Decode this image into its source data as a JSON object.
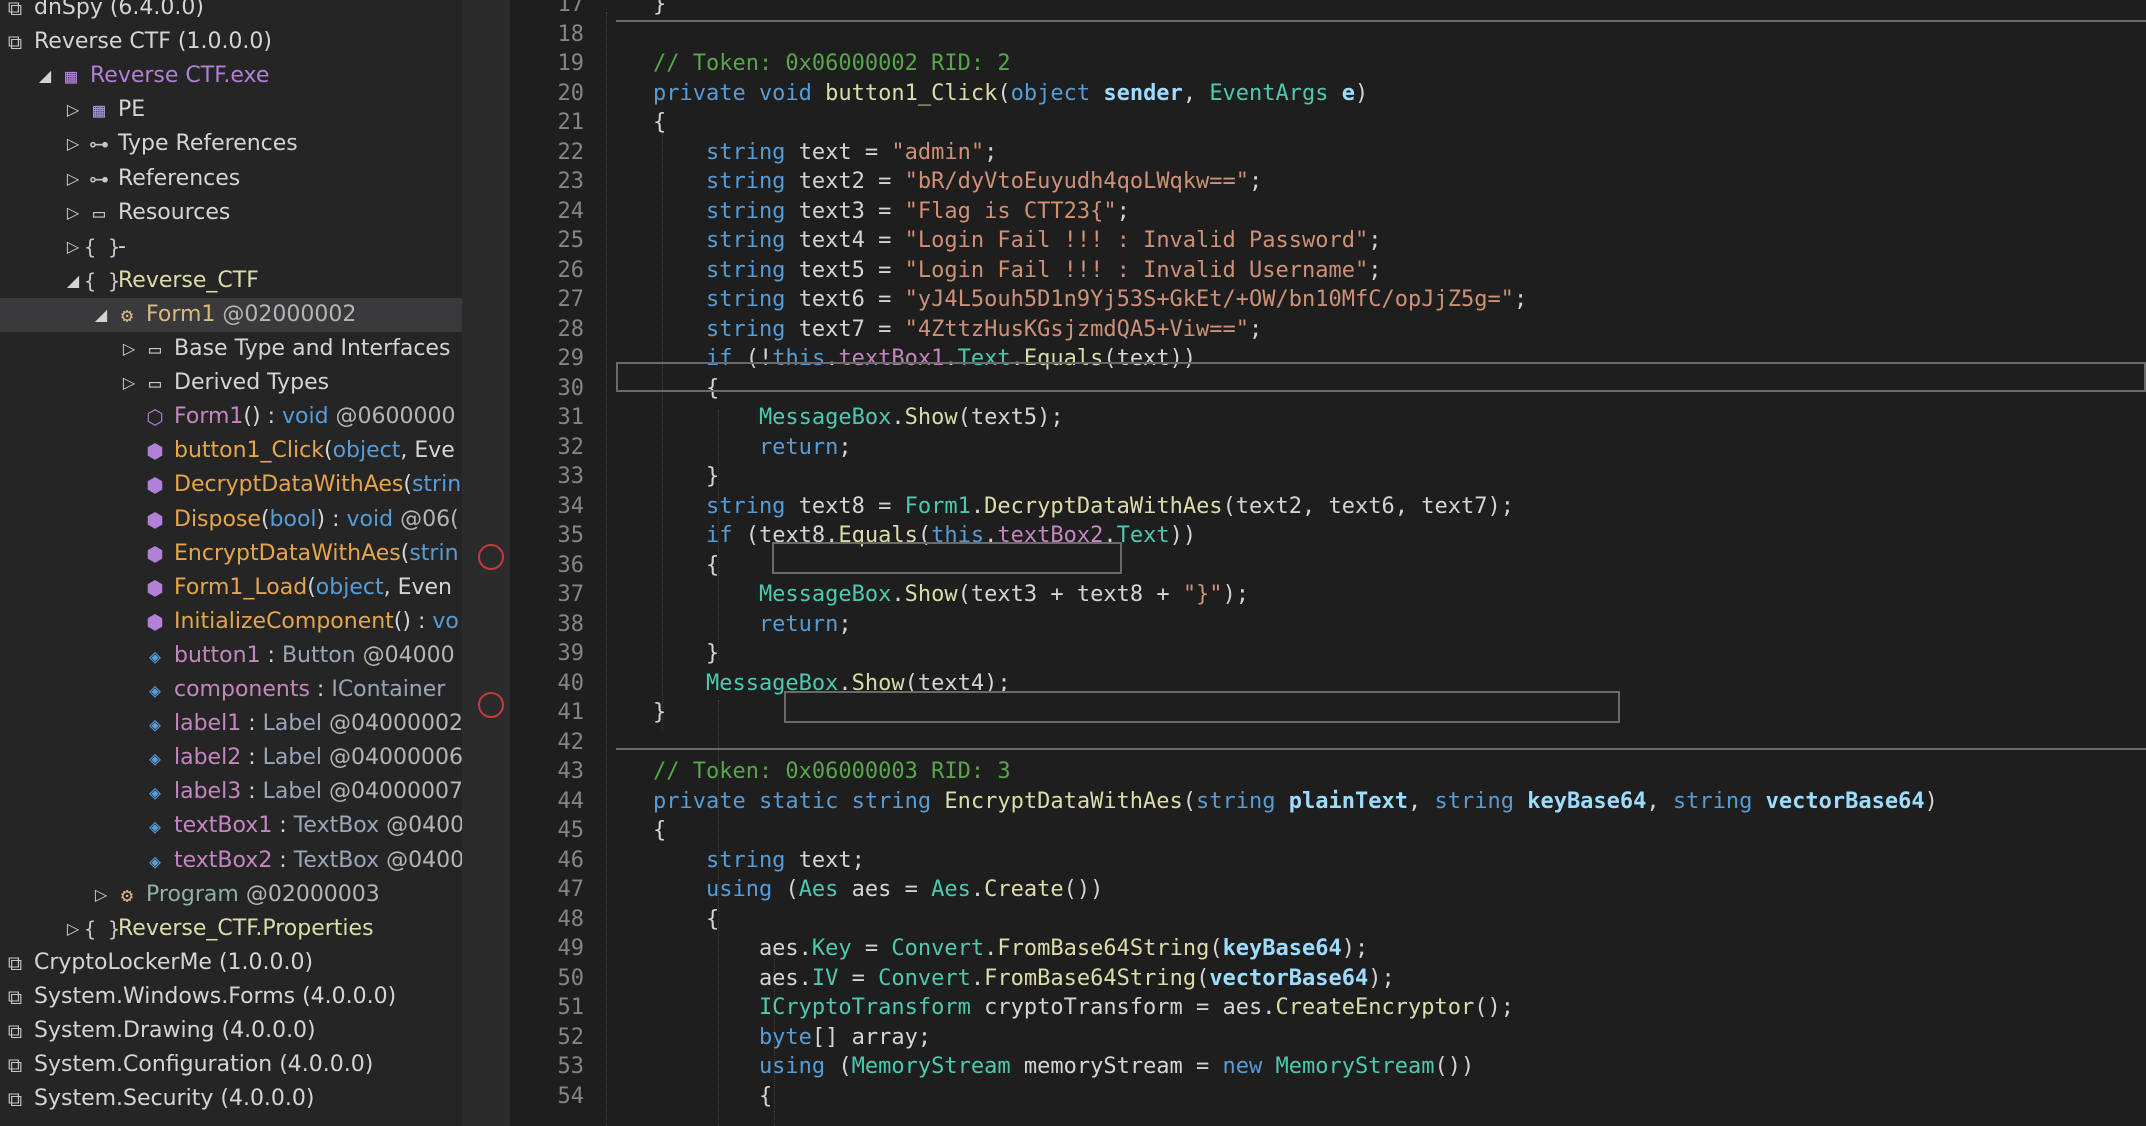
{
  "tree": [
    {
      "label": "dnSpy (6.4.0.0)",
      "kind": "asm",
      "indent": 0,
      "exp": ""
    },
    {
      "label": "Reverse CTF (1.0.0.0)",
      "kind": "asm",
      "indent": 0,
      "exp": ""
    },
    {
      "label": "Reverse CTF.exe",
      "kind": "exe",
      "indent": 1,
      "exp": "open"
    },
    {
      "label": "PE",
      "kind": "pe",
      "indent": 2,
      "exp": "closed"
    },
    {
      "label": "Type References",
      "kind": "ref",
      "indent": 2,
      "exp": "closed"
    },
    {
      "label": "References",
      "kind": "ref",
      "indent": 2,
      "exp": "closed"
    },
    {
      "label": "Resources",
      "kind": "folder",
      "indent": 2,
      "exp": "closed"
    },
    {
      "label": "-",
      "kind": "ns",
      "indent": 2,
      "exp": "closed"
    },
    {
      "label": "Reverse_CTF",
      "kind": "ns",
      "indent": 2,
      "exp": "open"
    },
    {
      "label": "Form1",
      "suffix": " @02000002",
      "kind": "class",
      "indent": 3,
      "exp": "open",
      "selected": true
    },
    {
      "label": "Base Type and Interfaces",
      "kind": "folder",
      "indent": 4,
      "exp": "closed"
    },
    {
      "label": "Derived Types",
      "kind": "folder",
      "indent": 4,
      "exp": "closed"
    },
    {
      "label": "Form1",
      "sig": "() : ",
      "sigtype": "void",
      "suffix": " @0600000",
      "kind": "ctor",
      "indent": 4,
      "exp": ""
    },
    {
      "label": "button1_Click",
      "sig": "(",
      "sigtype": "object",
      "sig2": ", Eve",
      "kind": "method",
      "indent": 4,
      "exp": ""
    },
    {
      "label": "DecryptDataWithAes",
      "sig": "(",
      "sigtype": "strin",
      "kind": "method",
      "indent": 4,
      "exp": ""
    },
    {
      "label": "Dispose",
      "sig": "(",
      "sigtype": "bool",
      "sig2": ") : ",
      "sigtype2": "void",
      "suffix": " @06(",
      "kind": "method2",
      "indent": 4,
      "exp": ""
    },
    {
      "label": "EncryptDataWithAes",
      "sig": "(",
      "sigtype": "strin",
      "kind": "method",
      "indent": 4,
      "exp": ""
    },
    {
      "label": "Form1_Load",
      "sig": "(",
      "sigtype": "object",
      "sig2": ", Even",
      "kind": "method",
      "indent": 4,
      "exp": ""
    },
    {
      "label": "InitializeComponent",
      "sig": "() : ",
      "sigtype": "vo",
      "kind": "method",
      "indent": 4,
      "exp": ""
    },
    {
      "label": "button1",
      "sig": " : ",
      "sigtype": "Button",
      "suffix": " @04000",
      "kind": "field",
      "indent": 4,
      "exp": ""
    },
    {
      "label": "components",
      "sig": " : ",
      "sigtype": "IContainer",
      "kind": "field",
      "indent": 4,
      "exp": ""
    },
    {
      "label": "label1",
      "sig": " : ",
      "sigtype": "Label",
      "suffix": " @04000002",
      "kind": "field",
      "indent": 4,
      "exp": ""
    },
    {
      "label": "label2",
      "sig": " : ",
      "sigtype": "Label",
      "suffix": " @04000006",
      "kind": "field",
      "indent": 4,
      "exp": ""
    },
    {
      "label": "label3",
      "sig": " : ",
      "sigtype": "Label",
      "suffix": " @04000007",
      "kind": "field",
      "indent": 4,
      "exp": ""
    },
    {
      "label": "textBox1",
      "sig": " : ",
      "sigtype": "TextBox",
      "suffix": " @0400",
      "kind": "field",
      "indent": 4,
      "exp": ""
    },
    {
      "label": "textBox2",
      "sig": " : ",
      "sigtype": "TextBox",
      "suffix": " @0400",
      "kind": "field",
      "indent": 4,
      "exp": ""
    },
    {
      "label": "Program",
      "suffix": " @02000003",
      "kind": "class2",
      "indent": 3,
      "exp": "closed"
    },
    {
      "label": "Reverse_CTF.Properties",
      "kind": "ns",
      "indent": 2,
      "exp": "closed"
    },
    {
      "label": "CryptoLockerMe (1.0.0.0)",
      "kind": "asm",
      "indent": 0,
      "exp": ""
    },
    {
      "label": "System.Windows.Forms (4.0.0.0)",
      "kind": "asm",
      "indent": 0,
      "exp": ""
    },
    {
      "label": "System.Drawing (4.0.0.0)",
      "kind": "asm",
      "indent": 0,
      "exp": ""
    },
    {
      "label": "System.Configuration (4.0.0.0)",
      "kind": "asm",
      "indent": 0,
      "exp": ""
    },
    {
      "label": "System.Security (4.0.0.0)",
      "kind": "asm",
      "indent": 0,
      "exp": ""
    }
  ],
  "code": [
    {
      "n": "17",
      "segs": [
        {
          "c": "id",
          "t": "    }"
        }
      ]
    },
    {
      "n": "18",
      "segs": []
    },
    {
      "n": "19",
      "segs": [
        {
          "c": "cm",
          "t": "    // Token: 0x06000002 RID: 2"
        }
      ]
    },
    {
      "n": "20",
      "segs": [
        {
          "c": "k",
          "t": "    private void "
        },
        {
          "c": "me",
          "t": "button1_Click"
        },
        {
          "c": "id",
          "t": "("
        },
        {
          "c": "k",
          "t": "object "
        },
        {
          "c": "pa",
          "t": "sender"
        },
        {
          "c": "id",
          "t": ", "
        },
        {
          "c": "ty",
          "t": "EventArgs "
        },
        {
          "c": "pa",
          "t": "e"
        },
        {
          "c": "id",
          "t": ")"
        }
      ]
    },
    {
      "n": "21",
      "segs": [
        {
          "c": "id",
          "t": "    {"
        }
      ]
    },
    {
      "n": "22",
      "segs": [
        {
          "c": "k",
          "t": "        string "
        },
        {
          "c": "id",
          "t": "text = "
        },
        {
          "c": "s",
          "t": "\"admin\""
        },
        {
          "c": "id",
          "t": ";"
        }
      ]
    },
    {
      "n": "23",
      "segs": [
        {
          "c": "k",
          "t": "        string "
        },
        {
          "c": "id",
          "t": "text2 = "
        },
        {
          "c": "s",
          "t": "\"bR/dyVtoEuyudh4qoLWqkw==\""
        },
        {
          "c": "id",
          "t": ";"
        }
      ]
    },
    {
      "n": "24",
      "segs": [
        {
          "c": "k",
          "t": "        string "
        },
        {
          "c": "id",
          "t": "text3 = "
        },
        {
          "c": "s",
          "t": "\"Flag is CTT23{\""
        },
        {
          "c": "id",
          "t": ";"
        }
      ]
    },
    {
      "n": "25",
      "segs": [
        {
          "c": "k",
          "t": "        string "
        },
        {
          "c": "id",
          "t": "text4 = "
        },
        {
          "c": "s",
          "t": "\"Login Fail !!! : Invalid Password\""
        },
        {
          "c": "id",
          "t": ";"
        }
      ]
    },
    {
      "n": "26",
      "segs": [
        {
          "c": "k",
          "t": "        string "
        },
        {
          "c": "id",
          "t": "text5 = "
        },
        {
          "c": "s",
          "t": "\"Login Fail !!! : Invalid Username\""
        },
        {
          "c": "id",
          "t": ";"
        }
      ]
    },
    {
      "n": "27",
      "segs": [
        {
          "c": "k",
          "t": "        string "
        },
        {
          "c": "id",
          "t": "text6 = "
        },
        {
          "c": "s",
          "t": "\"yJ4L5ouh5D1n9Yj53S+GkEt/+OW/bn10MfC/opJjZ5g=\""
        },
        {
          "c": "id",
          "t": ";"
        }
      ]
    },
    {
      "n": "28",
      "segs": [
        {
          "c": "k",
          "t": "        string "
        },
        {
          "c": "id",
          "t": "text7 = "
        },
        {
          "c": "s",
          "t": "\"4ZttzHusKGsjzmdQA5+Viw==\""
        },
        {
          "c": "id",
          "t": ";"
        }
      ]
    },
    {
      "n": "29",
      "segs": [
        {
          "c": "k",
          "t": "        if "
        },
        {
          "c": "id",
          "t": "(!"
        },
        {
          "c": "k",
          "t": "this"
        },
        {
          "c": "id",
          "t": "."
        },
        {
          "c": "fi",
          "t": "textBox1"
        },
        {
          "c": "id",
          "t": "."
        },
        {
          "c": "ty",
          "t": "Text"
        },
        {
          "c": "id",
          "t": "."
        },
        {
          "c": "me",
          "t": "Equals"
        },
        {
          "c": "id",
          "t": "(text))"
        }
      ]
    },
    {
      "n": "30",
      "segs": [
        {
          "c": "id",
          "t": "        {"
        }
      ]
    },
    {
      "n": "31",
      "segs": [
        {
          "c": "ty",
          "t": "            MessageBox"
        },
        {
          "c": "id",
          "t": "."
        },
        {
          "c": "me",
          "t": "Show"
        },
        {
          "c": "id",
          "t": "(text5);"
        }
      ]
    },
    {
      "n": "32",
      "segs": [
        {
          "c": "k",
          "t": "            return"
        },
        {
          "c": "id",
          "t": ";"
        }
      ]
    },
    {
      "n": "33",
      "segs": [
        {
          "c": "id",
          "t": "        }"
        }
      ]
    },
    {
      "n": "34",
      "segs": [
        {
          "c": "k",
          "t": "        string "
        },
        {
          "c": "id",
          "t": "text8 = "
        },
        {
          "c": "ty",
          "t": "Form1"
        },
        {
          "c": "id",
          "t": "."
        },
        {
          "c": "me",
          "t": "DecryptDataWithAes"
        },
        {
          "c": "id",
          "t": "(text2, text6, text7);"
        }
      ]
    },
    {
      "n": "35",
      "segs": [
        {
          "c": "k",
          "t": "        if "
        },
        {
          "c": "id",
          "t": "(text8."
        },
        {
          "c": "me",
          "t": "Equals"
        },
        {
          "c": "id",
          "t": "("
        },
        {
          "c": "k",
          "t": "this"
        },
        {
          "c": "id",
          "t": "."
        },
        {
          "c": "fi",
          "t": "textBox2"
        },
        {
          "c": "id",
          "t": "."
        },
        {
          "c": "ty",
          "t": "Text"
        },
        {
          "c": "id",
          "t": "))"
        }
      ]
    },
    {
      "n": "36",
      "segs": [
        {
          "c": "id",
          "t": "        {"
        }
      ]
    },
    {
      "n": "37",
      "segs": [
        {
          "c": "ty",
          "t": "            MessageBox"
        },
        {
          "c": "id",
          "t": "."
        },
        {
          "c": "me",
          "t": "Show"
        },
        {
          "c": "id",
          "t": "(text3 + text8 + "
        },
        {
          "c": "s",
          "t": "\"}\""
        },
        {
          "c": "id",
          "t": ");"
        }
      ]
    },
    {
      "n": "38",
      "segs": [
        {
          "c": "k",
          "t": "            return"
        },
        {
          "c": "id",
          "t": ";"
        }
      ]
    },
    {
      "n": "39",
      "segs": [
        {
          "c": "id",
          "t": "        }"
        }
      ]
    },
    {
      "n": "40",
      "segs": [
        {
          "c": "ty",
          "t": "        MessageBox"
        },
        {
          "c": "id",
          "t": "."
        },
        {
          "c": "me",
          "t": "Show"
        },
        {
          "c": "id",
          "t": "(text4);"
        }
      ]
    },
    {
      "n": "41",
      "segs": [
        {
          "c": "id",
          "t": "    }"
        }
      ]
    },
    {
      "n": "42",
      "segs": []
    },
    {
      "n": "43",
      "segs": [
        {
          "c": "cm",
          "t": "    // Token: 0x06000003 RID: 3"
        }
      ]
    },
    {
      "n": "44",
      "segs": [
        {
          "c": "k",
          "t": "    private static string "
        },
        {
          "c": "me",
          "t": "EncryptDataWithAes"
        },
        {
          "c": "id",
          "t": "("
        },
        {
          "c": "k",
          "t": "string "
        },
        {
          "c": "pa",
          "t": "plainText"
        },
        {
          "c": "id",
          "t": ", "
        },
        {
          "c": "k",
          "t": "string "
        },
        {
          "c": "pa",
          "t": "keyBase64"
        },
        {
          "c": "id",
          "t": ", "
        },
        {
          "c": "k",
          "t": "string "
        },
        {
          "c": "pa",
          "t": "vectorBase64"
        },
        {
          "c": "id",
          "t": ")"
        }
      ]
    },
    {
      "n": "45",
      "segs": [
        {
          "c": "id",
          "t": "    {"
        }
      ]
    },
    {
      "n": "46",
      "segs": [
        {
          "c": "k",
          "t": "        string "
        },
        {
          "c": "id",
          "t": "text;"
        }
      ]
    },
    {
      "n": "47",
      "segs": [
        {
          "c": "k",
          "t": "        using "
        },
        {
          "c": "id",
          "t": "("
        },
        {
          "c": "ty",
          "t": "Aes "
        },
        {
          "c": "id",
          "t": "aes = "
        },
        {
          "c": "ty",
          "t": "Aes"
        },
        {
          "c": "id",
          "t": "."
        },
        {
          "c": "me",
          "t": "Create"
        },
        {
          "c": "id",
          "t": "())"
        }
      ]
    },
    {
      "n": "48",
      "segs": [
        {
          "c": "id",
          "t": "        {"
        }
      ]
    },
    {
      "n": "49",
      "segs": [
        {
          "c": "id",
          "t": "            aes."
        },
        {
          "c": "ty",
          "t": "Key"
        },
        {
          "c": "id",
          "t": " = "
        },
        {
          "c": "ty",
          "t": "Convert"
        },
        {
          "c": "id",
          "t": "."
        },
        {
          "c": "me",
          "t": "FromBase64String"
        },
        {
          "c": "id",
          "t": "("
        },
        {
          "c": "pa",
          "t": "keyBase64"
        },
        {
          "c": "id",
          "t": ");"
        }
      ]
    },
    {
      "n": "50",
      "segs": [
        {
          "c": "id",
          "t": "            aes."
        },
        {
          "c": "ty",
          "t": "IV"
        },
        {
          "c": "id",
          "t": " = "
        },
        {
          "c": "ty",
          "t": "Convert"
        },
        {
          "c": "id",
          "t": "."
        },
        {
          "c": "me",
          "t": "FromBase64String"
        },
        {
          "c": "id",
          "t": "("
        },
        {
          "c": "pa",
          "t": "vectorBase64"
        },
        {
          "c": "id",
          "t": ");"
        }
      ]
    },
    {
      "n": "51",
      "segs": [
        {
          "c": "ty",
          "t": "            ICryptoTransform "
        },
        {
          "c": "id",
          "t": "cryptoTransform = aes."
        },
        {
          "c": "me",
          "t": "CreateEncryptor"
        },
        {
          "c": "id",
          "t": "();"
        }
      ]
    },
    {
      "n": "52",
      "segs": [
        {
          "c": "k",
          "t": "            byte"
        },
        {
          "c": "id",
          "t": "[] array;"
        }
      ]
    },
    {
      "n": "53",
      "segs": [
        {
          "c": "k",
          "t": "            using "
        },
        {
          "c": "id",
          "t": "("
        },
        {
          "c": "ty",
          "t": "MemoryStream "
        },
        {
          "c": "id",
          "t": "memoryStream = "
        },
        {
          "c": "k",
          "t": "new "
        },
        {
          "c": "ty",
          "t": "MemoryStream"
        },
        {
          "c": "id",
          "t": "())"
        }
      ]
    },
    {
      "n": "54",
      "segs": [
        {
          "c": "id",
          "t": "            {"
        }
      ]
    }
  ]
}
